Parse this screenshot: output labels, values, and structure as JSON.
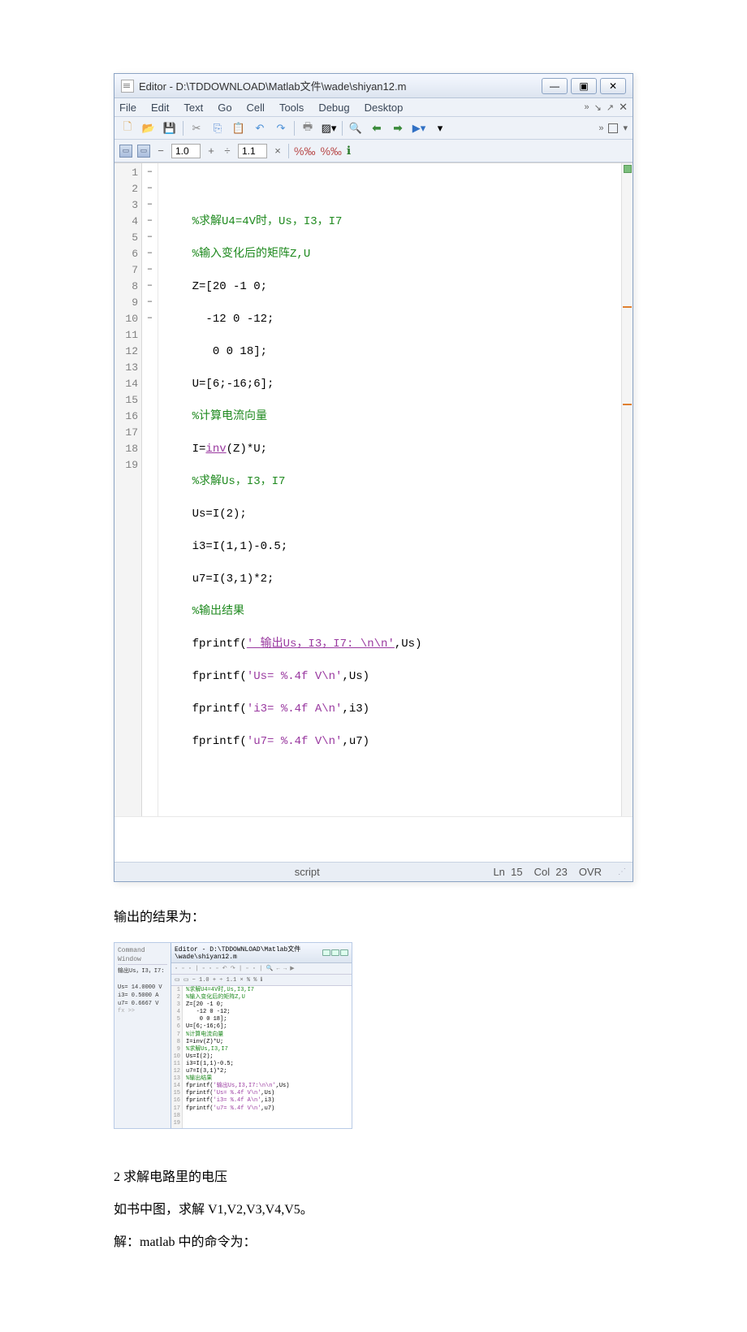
{
  "window": {
    "title": "Editor - D:\\TDDOWNLOAD\\Matlab文件\\wade\\shiyan12.m",
    "min": "—",
    "max": "▣",
    "close": "✕"
  },
  "menu": {
    "file": "File",
    "edit": "Edit",
    "text": "Text",
    "go": "Go",
    "cell": "Cell",
    "tools": "Tools",
    "debug": "Debug",
    "desktop": "Desktop",
    "more": "»"
  },
  "toolbar2": {
    "val1": "1.0",
    "val2": "1.1"
  },
  "gutter": [
    "1",
    "2",
    "3",
    "4",
    "5",
    "6",
    "7",
    "8",
    "9",
    "10",
    "11",
    "12",
    "13",
    "14",
    "15",
    "16",
    "17",
    "18",
    "19"
  ],
  "fold": [
    "",
    "",
    "",
    "–",
    "",
    "",
    "–",
    "",
    "–",
    "",
    "–",
    "–",
    "–",
    "",
    "–",
    "–",
    "–",
    "–",
    ""
  ],
  "code": {
    "l2": "%求解U4=4V时，Us，I3，I7",
    "l3": "%输入变化后的矩阵Z,U",
    "l4": "Z=[20 -1 0;",
    "l5": "-12 0 -12;",
    "l6": "0 0 18];",
    "l7": "U=[6;-16;6];",
    "l8": "%计算电流向量",
    "l9a": "I=",
    "l9b": "inv",
    "l9c": "(Z)*U;",
    "l10": "%求解Us，I3，I7",
    "l11": "Us=I(2);",
    "l12": "i3=I(1,1)-0.5;",
    "l13": "u7=I(3,1)*2;",
    "l14": "%输出结果",
    "l15a": "fprintf(",
    "l15b": "'_输出Us，I3，I7:_\\n\\n'",
    "l15c": ",Us)",
    "l16a": "fprintf(",
    "l16b": "'Us= %.4f V\\n'",
    "l16c": ",Us)",
    "l17a": "fprintf(",
    "l17b": "'i3= %.4f A\\n'",
    "l17c": ",i3)",
    "l18a": "fprintf(",
    "l18b": "'u7= %.4f V\\n'",
    "l18c": ",u7)"
  },
  "status": {
    "type": "script",
    "ln_label": "Ln",
    "ln": "15",
    "col_label": "Col",
    "col": "23",
    "mode": "OVR"
  },
  "doc": {
    "result_label": "输出的结果为：",
    "section2": "2 求解电路里的电压",
    "section2_desc": "如书中图，求解 V1,V2,V3,V4,V5。",
    "section2_sol": "解：matlab 中的命令为："
  },
  "thumb": {
    "cmd_title": "Command Window",
    "out_title": "输出Us，I3，I7:",
    "out1": "Us= 14.0000 V",
    "out2": "i3= 0.5000 A",
    "out3": "u7= 0.6667 V",
    "fx": "fx >>",
    "ed_title": "Editor - D:\\TDDOWNLOAD\\Matlab文件\\wade\\shiyan12.m"
  }
}
